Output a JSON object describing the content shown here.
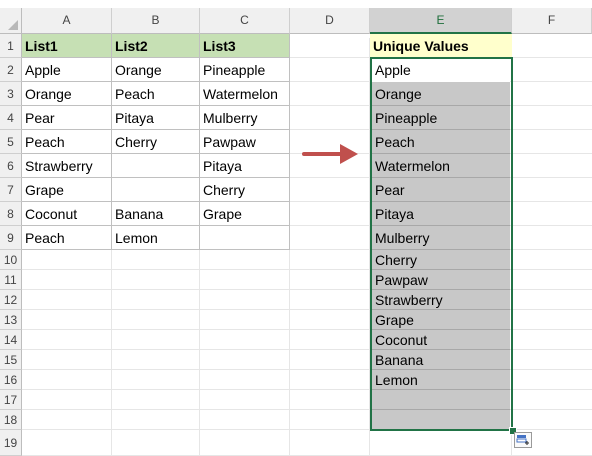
{
  "columns": [
    "A",
    "B",
    "C",
    "D",
    "E",
    "F"
  ],
  "selected_column": "E",
  "rows": [
    "1",
    "2",
    "3",
    "4",
    "5",
    "6",
    "7",
    "8",
    "9",
    "10",
    "11",
    "12",
    "13",
    "14",
    "15",
    "16",
    "17",
    "18",
    "19"
  ],
  "table": {
    "headers": [
      "List1",
      "List2",
      "List3"
    ],
    "rows": [
      [
        "Apple",
        "Orange",
        "Pineapple"
      ],
      [
        "Orange",
        "Peach",
        "Watermelon"
      ],
      [
        "Pear",
        "Pitaya",
        "Mulberry"
      ],
      [
        "Peach",
        "Cherry",
        "Pawpaw"
      ],
      [
        "Strawberry",
        "",
        "Pitaya"
      ],
      [
        "Grape",
        "",
        "Cherry"
      ],
      [
        "Coconut",
        "Banana",
        "Grape"
      ],
      [
        "Peach",
        "Lemon",
        ""
      ]
    ]
  },
  "unique": {
    "header": "Unique Values",
    "values": [
      "Apple",
      "Orange",
      "Pineapple",
      "Peach",
      "Watermelon",
      "Pear",
      "Pitaya",
      "Mulberry",
      "Cherry",
      "Pawpaw",
      "Strawberry",
      "Grape",
      "Coconut",
      "Banana",
      "Lemon",
      "",
      ""
    ]
  },
  "colors": {
    "header_green": "#c6e0b4",
    "header_yellow": "#ffffcc",
    "result_gray": "#c8c8c8",
    "selection_green": "#217346",
    "arrow_red": "#c0504d"
  },
  "icons": {
    "arrow": "right-arrow-icon",
    "quick_analysis": "quick-analysis-icon"
  }
}
